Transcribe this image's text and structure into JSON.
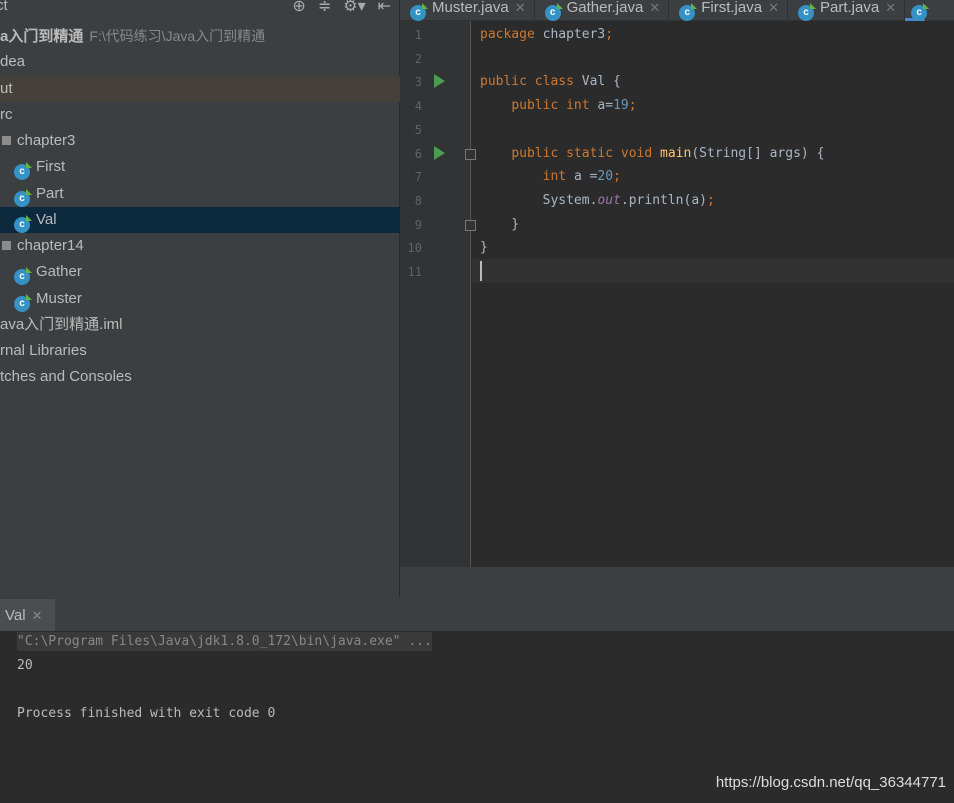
{
  "sidebar": {
    "title": "ct",
    "tools": [
      "⊕",
      "≑",
      "⚙▾",
      "⇤"
    ],
    "items": [
      {
        "label": "a入门到精通",
        "path": "F:\\代码练习\\Java入门到精通",
        "bold": true
      },
      {
        "label": "dea"
      },
      {
        "label": "ut",
        "state": "excluded"
      },
      {
        "label": "rc"
      },
      {
        "label": "chapter3",
        "type": "package"
      },
      {
        "label": "First",
        "type": "class"
      },
      {
        "label": "Part",
        "type": "class"
      },
      {
        "label": "Val",
        "type": "class",
        "selected": true
      },
      {
        "label": "chapter14",
        "type": "package"
      },
      {
        "label": "Gather",
        "type": "class"
      },
      {
        "label": "Muster",
        "type": "class"
      },
      {
        "label": "ava入门到精通.iml"
      },
      {
        "label": "rnal Libraries"
      },
      {
        "label": "tches and Consoles"
      }
    ]
  },
  "tabs": [
    {
      "label": "Muster.java"
    },
    {
      "label": "Gather.java"
    },
    {
      "label": "First.java"
    },
    {
      "label": "Part.java"
    },
    {
      "label": "",
      "active": true
    }
  ],
  "editor": {
    "lines": [
      [
        [
          "kw",
          "package "
        ],
        [
          "pl",
          "chapter3"
        ],
        [
          "kw",
          ";"
        ]
      ],
      [],
      [
        [
          "kw",
          "public class "
        ],
        [
          "pl",
          "Val {"
        ]
      ],
      [
        [
          "pl",
          "    "
        ],
        [
          "kw",
          "public int "
        ],
        [
          "pl",
          "a="
        ],
        [
          "num",
          "19"
        ],
        [
          "kw",
          ";"
        ]
      ],
      [],
      [
        [
          "pl",
          "    "
        ],
        [
          "kw",
          "public static void "
        ],
        [
          "fn",
          "main"
        ],
        [
          "pl",
          "(String[] args) {"
        ]
      ],
      [
        [
          "pl",
          "        "
        ],
        [
          "kw",
          "int "
        ],
        [
          "pl",
          "a ="
        ],
        [
          "num",
          "20"
        ],
        [
          "kw",
          ";"
        ]
      ],
      [
        [
          "pl",
          "        System."
        ],
        [
          "fld",
          "out"
        ],
        [
          "pl",
          ".println(a)"
        ],
        [
          "kw",
          ";"
        ]
      ],
      [
        [
          "pl",
          "    }"
        ]
      ],
      [
        [
          "pl",
          "}"
        ]
      ],
      []
    ],
    "line_numbers": [
      "1",
      "2",
      "3",
      "4",
      "5",
      "6",
      "7",
      "8",
      "9",
      "10",
      "11"
    ]
  },
  "run_panel": {
    "tab": "Val",
    "output": [
      "\"C:\\Program Files\\Java\\jdk1.8.0_172\\bin\\java.exe\" ...",
      "20",
      "",
      "Process finished with exit code 0"
    ]
  },
  "watermark": "https://blog.csdn.net/qq_36344771"
}
